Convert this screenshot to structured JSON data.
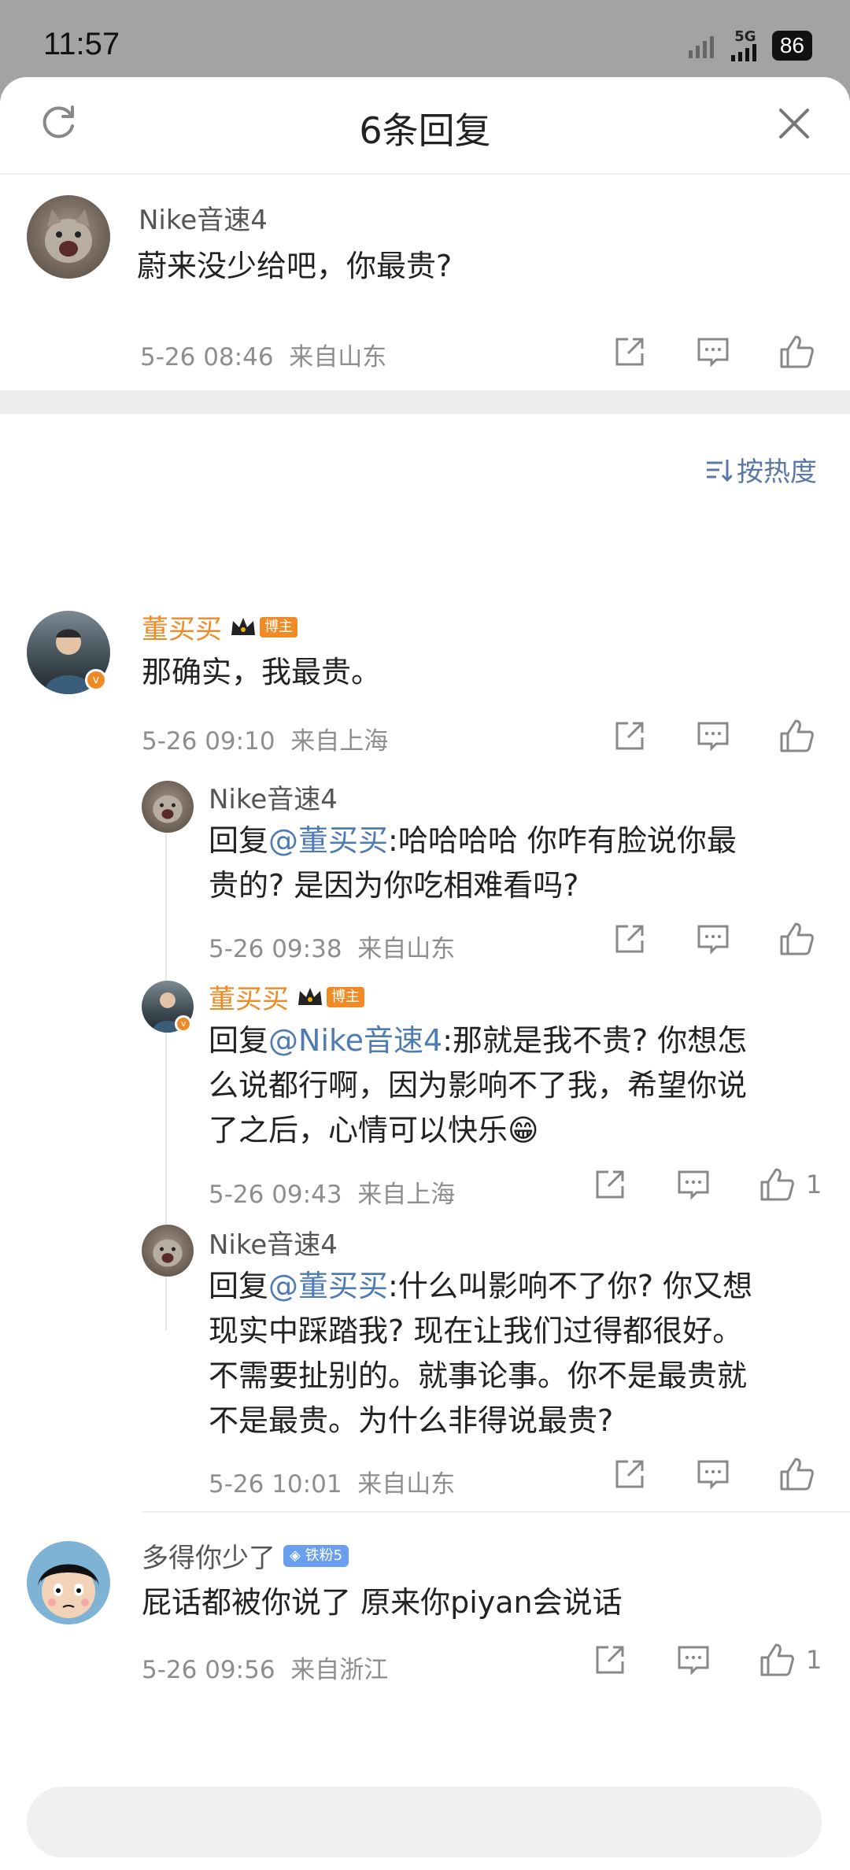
{
  "status_bar": {
    "time": "11:57",
    "network": "5G",
    "battery": "86"
  },
  "header": {
    "title": "6条回复"
  },
  "root_comment": {
    "user": "Nike音速4",
    "text": "蔚来没少给吧，你最贵?",
    "date": "5-26 08:46",
    "location": "来自山东"
  },
  "sort": {
    "label": "按热度"
  },
  "main_comment": {
    "user": "董买买",
    "badge": "博主",
    "text": "那确实，我最贵。",
    "date": "5-26 09:10",
    "location": "来自上海"
  },
  "replies": [
    {
      "user": "Nike音速4",
      "reply_prefix": "回复",
      "mention": "@董买买",
      "text_line1": ":哈哈哈哈    你咋有脸说你最",
      "text_line2": "贵的? 是因为你吃相难看吗?",
      "date": "5-26 09:38",
      "location": "来自山东"
    },
    {
      "user": "董买买",
      "badge": "博主",
      "reply_prefix": "回复",
      "mention": "@Nike音速4",
      "text_line1": ":那就是我不贵? 你想怎",
      "text_line2": "么说都行啊，因为影响不了我，希望你说",
      "text_line3": "了之后，心情可以快乐😁",
      "date": "5-26 09:43",
      "location": "来自上海",
      "likes": "1"
    },
    {
      "user": "Nike音速4",
      "reply_prefix": "回复",
      "mention": "@董买买",
      "text_line1": ":什么叫影响不了你? 你又想",
      "text_line2": "现实中踩踏我? 现在让我们过得都很好。",
      "text_line3": "不需要扯别的。就事论事。你不是最贵就",
      "text_line4": "不是最贵。为什么非得说最贵?",
      "date": "5-26 10:01",
      "location": "来自山东"
    }
  ],
  "other_comment": {
    "user": "多得你少了",
    "badge": "铁粉5",
    "text": "屁话都被你说了 原来你piyan会说话",
    "date": "5-26 09:56",
    "location": "来自浙江",
    "likes": "1"
  },
  "colors": {
    "accent_orange": "#f08a24",
    "link_blue": "#4f7bb3",
    "sort_blue": "#5b79a6"
  }
}
